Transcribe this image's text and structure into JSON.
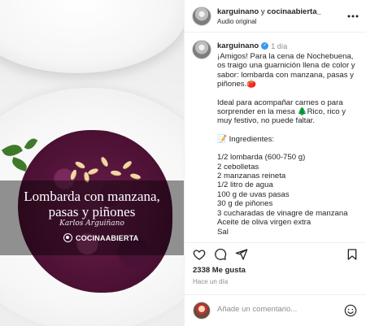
{
  "media": {
    "title_lines": [
      "Lombarda con manzana,",
      "pasas y piñones"
    ],
    "signature": "Karlos Arguiñano",
    "brand": "COCINAABIERTA"
  },
  "header": {
    "user_main": "karguinano",
    "connector": " y ",
    "user_collab": "cocinaabierta_",
    "audio": "Audio original",
    "more_icon": "more-icon"
  },
  "caption": {
    "username": "karguinano",
    "verified_icon": "verified-icon",
    "time": "1 día",
    "lines": [
      "¡Amigos! Para la cena de Nochebuena, os traigo una guarnición llena de color y sabor: lombarda con manzana, pasas y piñones.🍅",
      "",
      "Ideal para acompañar carnes o para sorprender en la mesa 🌲Rico, rico y muy festivo, no puede faltar.",
      "",
      "📝 Ingredientes:",
      "",
      "1/2 lombarda (600-750 g)",
      "2 cebolletas",
      "2 manzanas reineta",
      "1/2 litro de agua",
      "100 g de uvas pasas",
      "30 g de piñones",
      "3 cucharadas de vinagre de manzana",
      "Aceite de oliva virgen extra",
      "Sal"
    ]
  },
  "actions": {
    "likes": "2338 Me gusta",
    "posted": "Hace un día"
  },
  "comment": {
    "placeholder": "Añade un comentario..."
  }
}
